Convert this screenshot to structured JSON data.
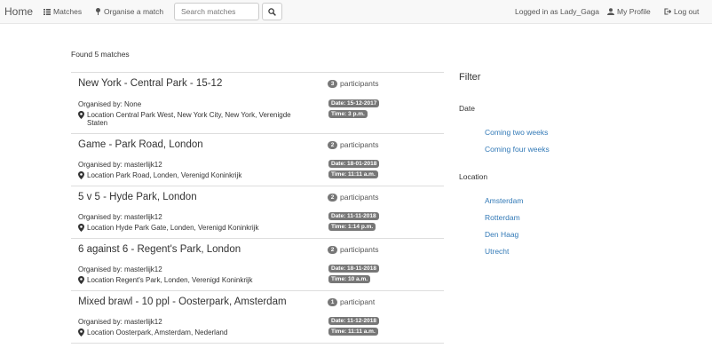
{
  "navbar": {
    "brand": "Home",
    "matches_label": "Matches",
    "organise_label": "Organise a match",
    "search_placeholder": "Search matches",
    "logged_in_text": "Logged in as Lady_Gaga",
    "profile_label": "My Profile",
    "logout_label": "Log out"
  },
  "summary": "Found 5 matches",
  "matches": [
    {
      "title": "New York - Central Park - 15-12",
      "count": "3",
      "participants_label": "participants",
      "organised": "Organised by: None",
      "location": "Location Central Park West, New York City, New York, Verenigde Staten",
      "date": "Date: 15-12-2017",
      "time": "Time: 3 p.m."
    },
    {
      "title": "Game - Park Road, London",
      "count": "2",
      "participants_label": "participants",
      "organised": "Organised by: masterlijk12",
      "location": "Location Park Road, Londen, Verenigd Koninkrijk",
      "date": "Date: 18-01-2018",
      "time": "Time: 11:11 a.m."
    },
    {
      "title": "5 v 5 - Hyde Park, London",
      "count": "2",
      "participants_label": "participants",
      "organised": "Organised by: masterlijk12",
      "location": "Location Hyde Park Gate, Londen, Verenigd Koninkrijk",
      "date": "Date: 11-11-2018",
      "time": "Time: 1:14 p.m."
    },
    {
      "title": "6 against 6 - Regent's Park, London",
      "count": "2",
      "participants_label": "participants",
      "organised": "Organised by: masterlijk12",
      "location": "Location Regent's Park, Londen, Verenigd Koninkrijk",
      "date": "Date: 18-11-2018",
      "time": "Time: 10 a.m."
    },
    {
      "title": "Mixed brawl - 10 ppl - Oosterpark, Amsterdam",
      "count": "1",
      "participants_label": "participant",
      "organised": "Organised by: masterlijk12",
      "location": "Location Oosterpark, Amsterdam, Nederland",
      "date": "Date: 11-12-2018",
      "time": "Time: 11:11 a.m."
    }
  ],
  "filter": {
    "title": "Filter",
    "date_heading": "Date",
    "date_options": [
      "Coming two weeks",
      "Coming four weeks"
    ],
    "location_heading": "Location",
    "location_options": [
      "Amsterdam",
      "Rotterdam",
      "Den Haag",
      "Utrecht"
    ]
  }
}
